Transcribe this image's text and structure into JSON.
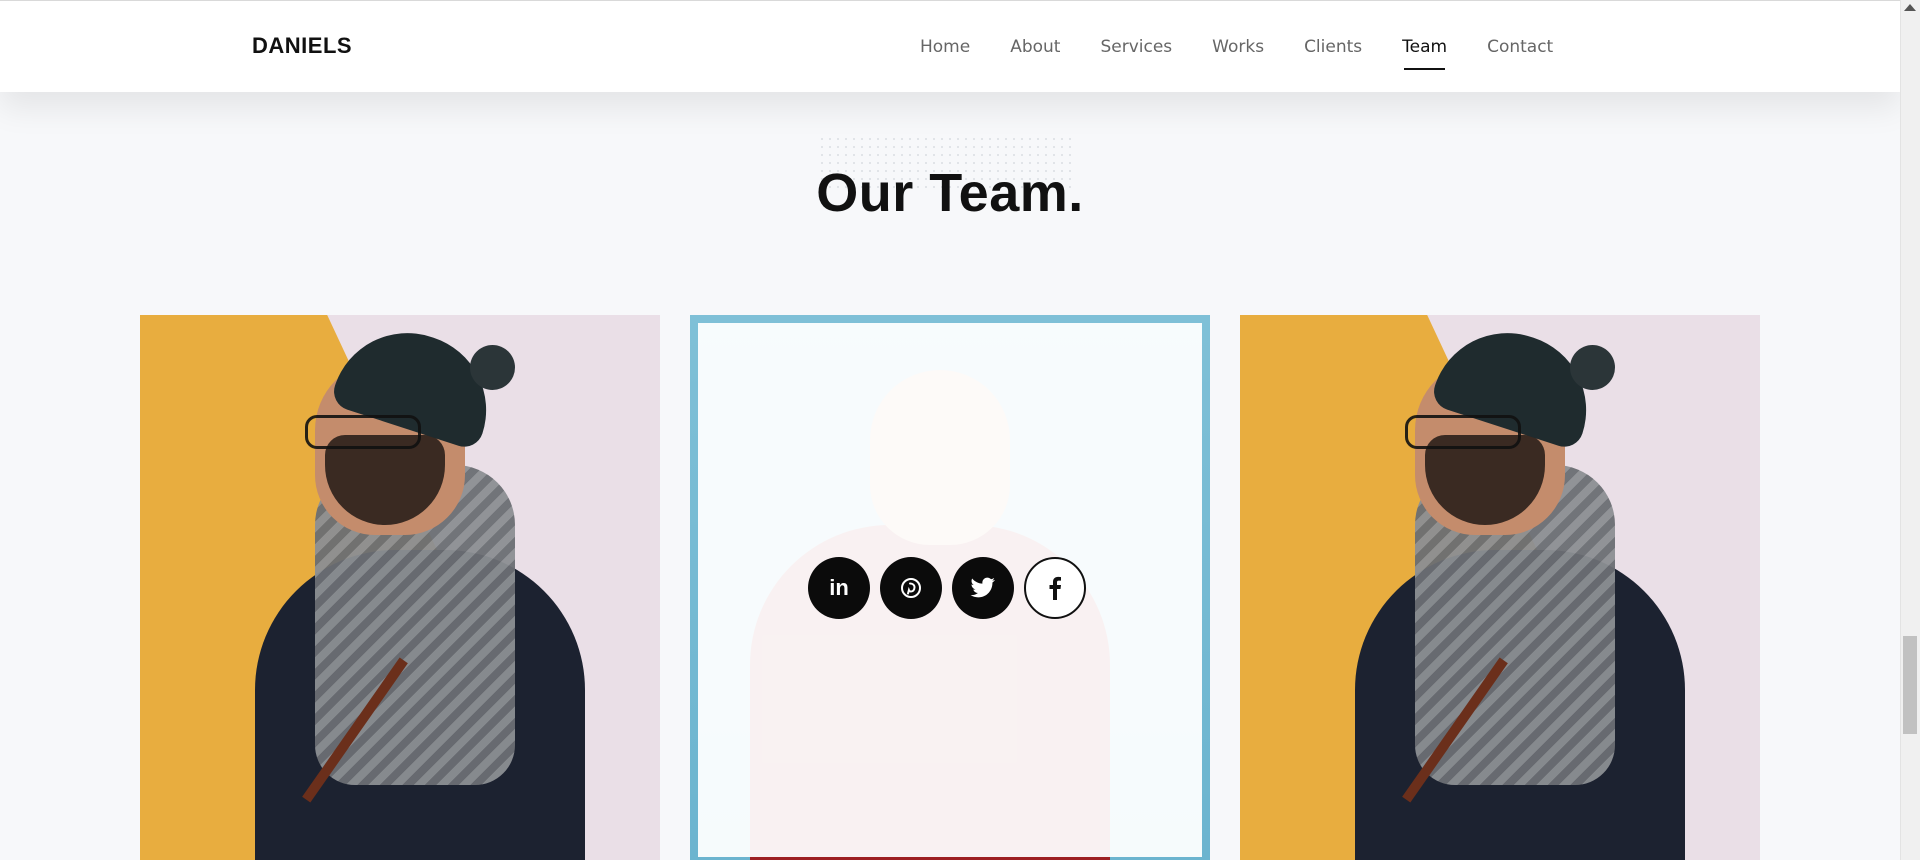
{
  "header": {
    "logo": "DANIELS",
    "nav": [
      "Home",
      "About",
      "Services",
      "Works",
      "Clients",
      "Team",
      "Contact"
    ],
    "active": "Team"
  },
  "team": {
    "title": "Our Team."
  },
  "social": {
    "icons": [
      "linkedin-icon",
      "pinterest-icon",
      "twitter-icon",
      "facebook-icon"
    ]
  },
  "colors": {
    "accent": "#0b0b0b",
    "background": "#f7f8fa",
    "header": "#ffffff"
  }
}
